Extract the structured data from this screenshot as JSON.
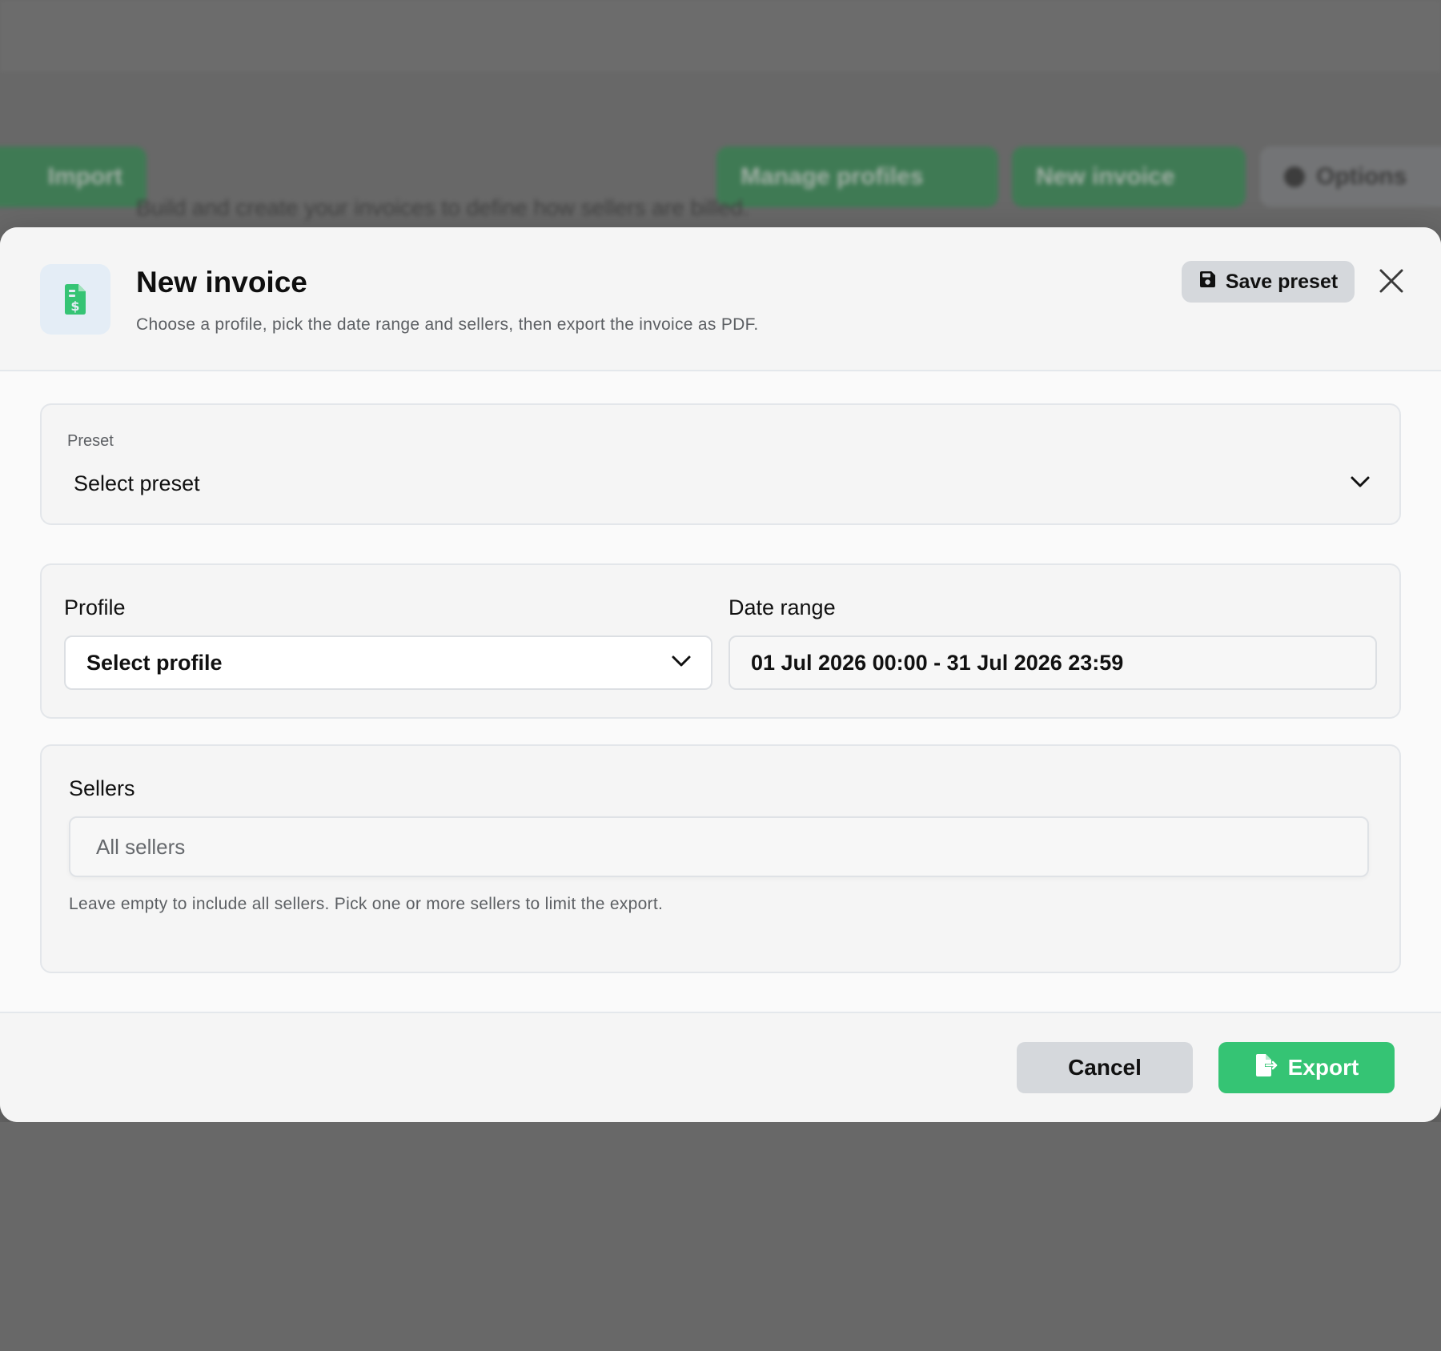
{
  "background": {
    "buttons": {
      "left_partial": "Import",
      "manage_profiles": "Manage profiles",
      "new_invoice": "New invoice",
      "options": "Options"
    },
    "subtitle": "Build and create your invoices to define how sellers are billed."
  },
  "modal": {
    "title": "New invoice",
    "subtitle": "Choose a profile, pick the date range and sellers, then export the invoice as PDF.",
    "icon": "file-invoice-dollar-icon",
    "save_preset_label": "Save preset",
    "close_icon": "close-icon",
    "preset": {
      "label": "Preset",
      "value": "Select preset"
    },
    "profile": {
      "label": "Profile",
      "value": "Select profile"
    },
    "date_range": {
      "label": "Date range",
      "value": "01 Jul 2026 00:00 - 31 Jul 2026 23:59"
    },
    "sellers": {
      "label": "Sellers",
      "placeholder": "All sellers",
      "help": "Leave empty to include all sellers. Pick one or more sellers to limit the export."
    },
    "footer": {
      "cancel_label": "Cancel",
      "export_label": "Export"
    }
  },
  "colors": {
    "accent": "#35c474",
    "overlay": "#686868",
    "modal_bg": "#fafafa"
  }
}
